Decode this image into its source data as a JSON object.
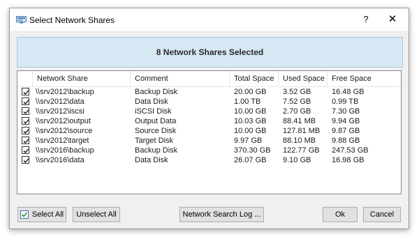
{
  "window": {
    "title": "Select Network Shares",
    "help_glyph": "?",
    "close_glyph": "✕"
  },
  "banner": {
    "text": "8 Network Shares Selected"
  },
  "table": {
    "columns": [
      "Network Share",
      "Comment",
      "Total Space",
      "Used Space",
      "Free Space"
    ],
    "rows": [
      {
        "checked": true,
        "share": "\\\\srv2012\\backup",
        "comment": "Backup Disk",
        "total": "20.00 GB",
        "used": "3.52 GB",
        "free": "16.48 GB"
      },
      {
        "checked": true,
        "share": "\\\\srv2012\\data",
        "comment": "Data Disk",
        "total": "1.00 TB",
        "used": "7.52 GB",
        "free": "0.99 TB"
      },
      {
        "checked": true,
        "share": "\\\\srv2012\\iscsi",
        "comment": "iSCSI Disk",
        "total": "10.00 GB",
        "used": "2.70 GB",
        "free": "7.30 GB"
      },
      {
        "checked": true,
        "share": "\\\\srv2012\\output",
        "comment": "Output Data",
        "total": "10.03 GB",
        "used": "88.41 MB",
        "free": "9.94 GB"
      },
      {
        "checked": true,
        "share": "\\\\srv2012\\source",
        "comment": "Source Disk",
        "total": "10.00 GB",
        "used": "127.81 MB",
        "free": "9.87 GB"
      },
      {
        "checked": true,
        "share": "\\\\srv2012\\target",
        "comment": "Target Disk",
        "total": "9.97 GB",
        "used": "88.10 MB",
        "free": "9.88 GB"
      },
      {
        "checked": true,
        "share": "\\\\srv2016\\backup",
        "comment": "Backup Disk",
        "total": "370.30 GB",
        "used": "122.77 GB",
        "free": "247.53 GB"
      },
      {
        "checked": true,
        "share": "\\\\srv2016\\data",
        "comment": "Data Disk",
        "total": "26.07 GB",
        "used": "9.10 GB",
        "free": "16.98 GB"
      }
    ]
  },
  "buttons": {
    "select_all": "Select All",
    "unselect_all": "Unselect All",
    "search_log": "Network Search Log ...",
    "ok": "Ok",
    "cancel": "Cancel"
  },
  "icons": {
    "app": "network-shares-icon",
    "select_all": "checklist-icon"
  },
  "colors": {
    "banner_bg": "#d5e8f4",
    "window_bg": "#f0f0f0"
  }
}
